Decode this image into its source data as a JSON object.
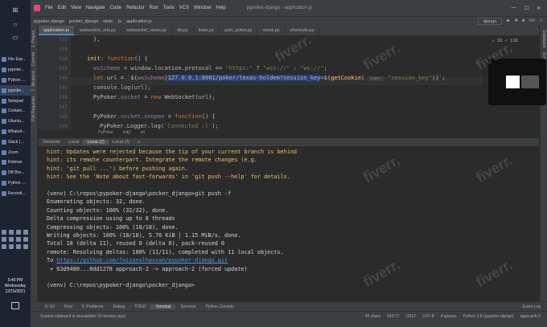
{
  "taskbar": {
    "apps": [
      {
        "label": "File Exp..."
      },
      {
        "label": "pypoke..."
      },
      {
        "label": "Python ..."
      },
      {
        "label": "pypoke...",
        "active": true
      },
      {
        "label": "Notepad"
      },
      {
        "label": "Contain..."
      },
      {
        "label": "Ubuntu..."
      },
      {
        "label": "WhatsA..."
      },
      {
        "label": "Slack | ..."
      },
      {
        "label": "Zoom"
      },
      {
        "label": "Rotman"
      },
      {
        "label": "DB Bro..."
      },
      {
        "label": "Python ..."
      },
      {
        "label": "Recordi..."
      }
    ],
    "clock_time": "5:40 PM",
    "clock_day": "Wednesday",
    "clock_date": "12/15/2021"
  },
  "menubar": {
    "items": [
      "File",
      "Edit",
      "View",
      "Navigate",
      "Code",
      "Refactor",
      "Run",
      "Tools",
      "VCS",
      "Window",
      "Help"
    ],
    "title": "pypoker-django - application.js"
  },
  "navbar": {
    "crumbs": [
      "pypoker-django",
      "pocker_django",
      "static",
      "js",
      "application.js"
    ],
    "run_config": "django"
  },
  "tabs": [
    "application.js",
    "websocket_urls.py",
    "websocket_views.py",
    "db.py",
    "base.py",
    "auto_poker.py",
    "views.py",
    "shortcuts.py"
  ],
  "editor": {
    "indicator": "⚠ 10  ✓ 118",
    "lines": [
      {
        "num": "537",
        "code": "},"
      },
      {
        "num": "538",
        "code": ""
      },
      {
        "num": "539",
        "code": "init: function() {"
      },
      {
        "num": "540",
        "code": "wsScheme = window.location.protocol == \"https:\" ? \"wss://\" : \"ws://\";"
      },
      {
        "num": "544",
        "code": "let url = `${wsScheme}127.0.0.1:8001/poker/texas-holdem?session_key=${getCookie( name: \"session_key\")}`;"
      },
      {
        "num": "545",
        "code": "console.log(url);"
      },
      {
        "num": "546",
        "code": "PyPoker.socket = new WebSocket(url);"
      },
      {
        "num": "547",
        "code": ""
      },
      {
        "num": "548",
        "code": "PyPoker.socket.onopen = function() {"
      },
      {
        "num": "549",
        "code": "PyPoker.Logger.log('Connected :)');"
      }
    ],
    "breadcrumbs": [
      "PyPoker",
      "init()",
      "url"
    ]
  },
  "terminal": {
    "tabs": [
      "Terminal:",
      "Local",
      "Local (2)",
      "Local (2)",
      "+"
    ],
    "lines": [
      "hint: Updates were rejected because the tip of your current branch is behind",
      "hint: its remote counterpart. Integrate the remote changes (e.g.",
      "hint: 'git pull ...') before pushing again.",
      "hint: See the 'Note about fast-forwards' in 'git push --help' for details.",
      "",
      "(venv) C:\\repos\\pypoker-django\\pocker_django>git push -f",
      "Enumerating objects: 32, done.",
      "Counting objects: 100% (32/32), done.",
      "Delta compression using up to 8 threads",
      "Compressing objects: 100% (18/18), done.",
      "Writing objects: 100% (18/18), 5.76 KiB | 1.15 MiB/s, done.",
      "Total 18 (delta 11), reused 0 (delta 0), pack-reused 0",
      "remote: Resolving deltas: 100% (11/11), completed with 11 local objects.",
      "To https://github.com/faizanalhassan/pypoker-django.git",
      " + 63d9480...0dd1278 approach-2 -> approach-2 (forced update)",
      "",
      "(venv) C:\\repos\\pypoker-django\\pocker_django>"
    ],
    "link": "https://github.com/faizanalhassan/pypoker-django.git"
  },
  "bottom_tabs": [
    "6: Git",
    "Find",
    "6: Problems",
    "Debug",
    "TODO",
    "Terminal",
    "Services",
    "Python Console",
    "Event Log"
  ],
  "status": {
    "left": "System clipboard is unavailable (8 minutes ago)",
    "right": [
      "45 chars",
      "544:77",
      "CRLF",
      "UTF-8",
      "4 spaces",
      "Python 3.8 (pypoker-django)",
      "approach-2"
    ]
  },
  "watermark": "fiverr."
}
